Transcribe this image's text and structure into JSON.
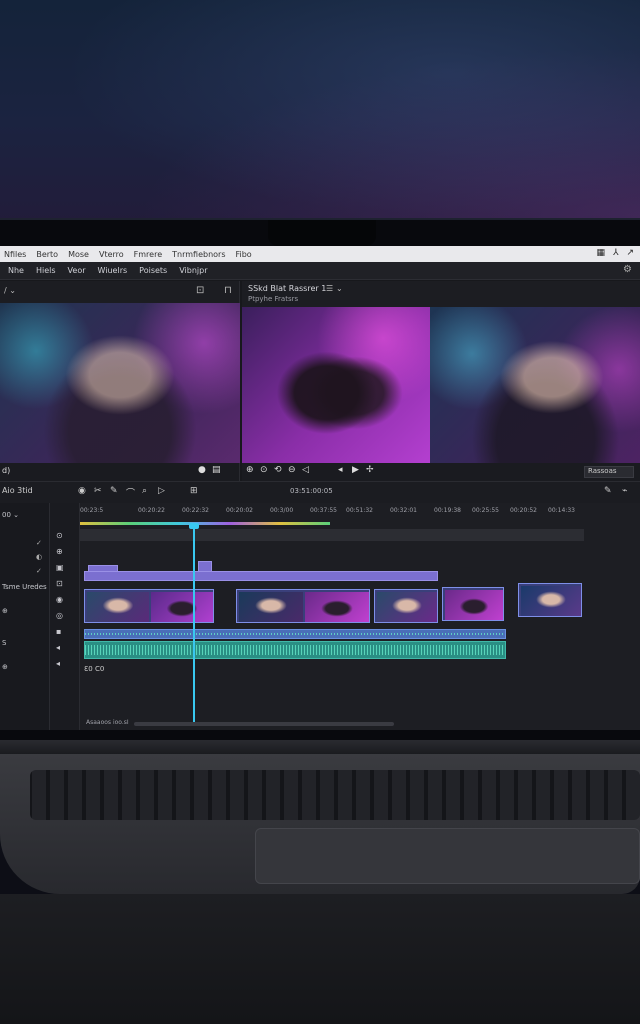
{
  "os_menu": [
    "Nfiles",
    "Berto",
    "Mose",
    "Vterro",
    "Fmrere",
    "Tnrmfiebnors",
    "Fibo"
  ],
  "app_menu": [
    "Nhe",
    "Hiels",
    "Veor",
    "Wiuelrs",
    "Poisets",
    "Vibnjpr"
  ],
  "source_monitor": {
    "selector": "/ ⌄",
    "timecode": "d)"
  },
  "program_monitor": {
    "title": "SSkd Blat Rassrer 1",
    "subtitle": "Ptpyhe Fratsrs",
    "fit_label": "Rassoas"
  },
  "timeline": {
    "toolbar_left": "Aio  3tid",
    "toolbar_timecode": "03:51:00:05",
    "ruler_ticks": [
      "00:23:5",
      "00:20:22",
      "00:22:32",
      "00:20:02",
      "00:3/00",
      "00:37:55",
      "00:51:32",
      "00:32:01",
      "00:19:38",
      "00:25:55",
      "00:20:52",
      "00:14:33"
    ],
    "sidebar_labels": [
      "00 ⌄",
      "Tsme Uredes",
      "⊕",
      "S",
      "⊕"
    ],
    "footer_text": "Asaaoos ioo.sI",
    "audio_label": "Ɛ0 C0"
  },
  "colors": {
    "playhead": "#39c8f0",
    "video_track": "#7b6fd0",
    "audio_track": "#2a8f84",
    "accent_purple": "#b43fd0"
  }
}
